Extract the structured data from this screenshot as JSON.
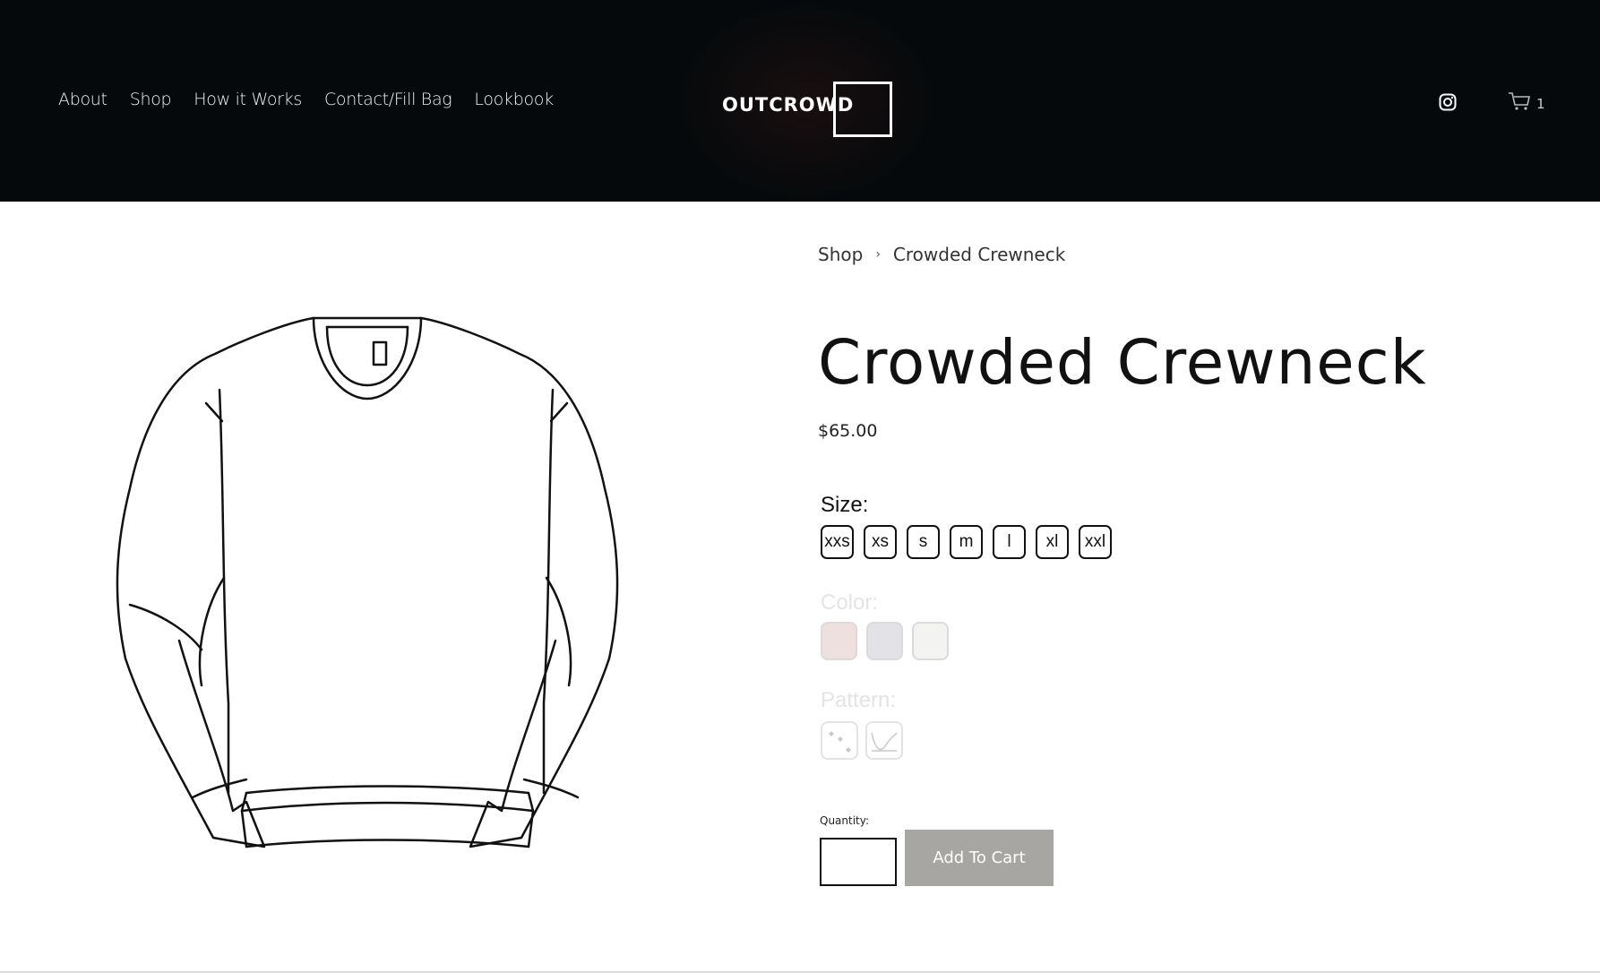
{
  "header": {
    "nav": [
      "About",
      "Shop",
      "How it Works",
      "Contact/Fill Bag",
      "Lookbook"
    ],
    "logo_text": "OUTCROWD",
    "instagram_icon": "instagram-icon",
    "cart_icon": "cart-icon",
    "cart_count": "1"
  },
  "breadcrumb": {
    "parent": "Shop",
    "separator": "›",
    "current": "Crowded Crewneck"
  },
  "product": {
    "title": "Crowded Crewneck",
    "price": "$65.00",
    "size_label": "Size:",
    "sizes": [
      "xxs",
      "xs",
      "s",
      "m",
      "l",
      "xl",
      "xxl"
    ],
    "color_label": "Color:",
    "colors": [
      "#e6d4d2",
      "#d6d6dd",
      "#eeeeec"
    ],
    "pattern_label": "Pattern:",
    "patterns": [
      "dots-pattern-icon",
      "wave-pattern-icon"
    ],
    "quantity_label": "Quantity:",
    "quantity_value": "",
    "add_to_cart_label": "Add To Cart"
  },
  "colors": {
    "header_bg": "#06090b",
    "button_bg": "#a8a6a3"
  }
}
